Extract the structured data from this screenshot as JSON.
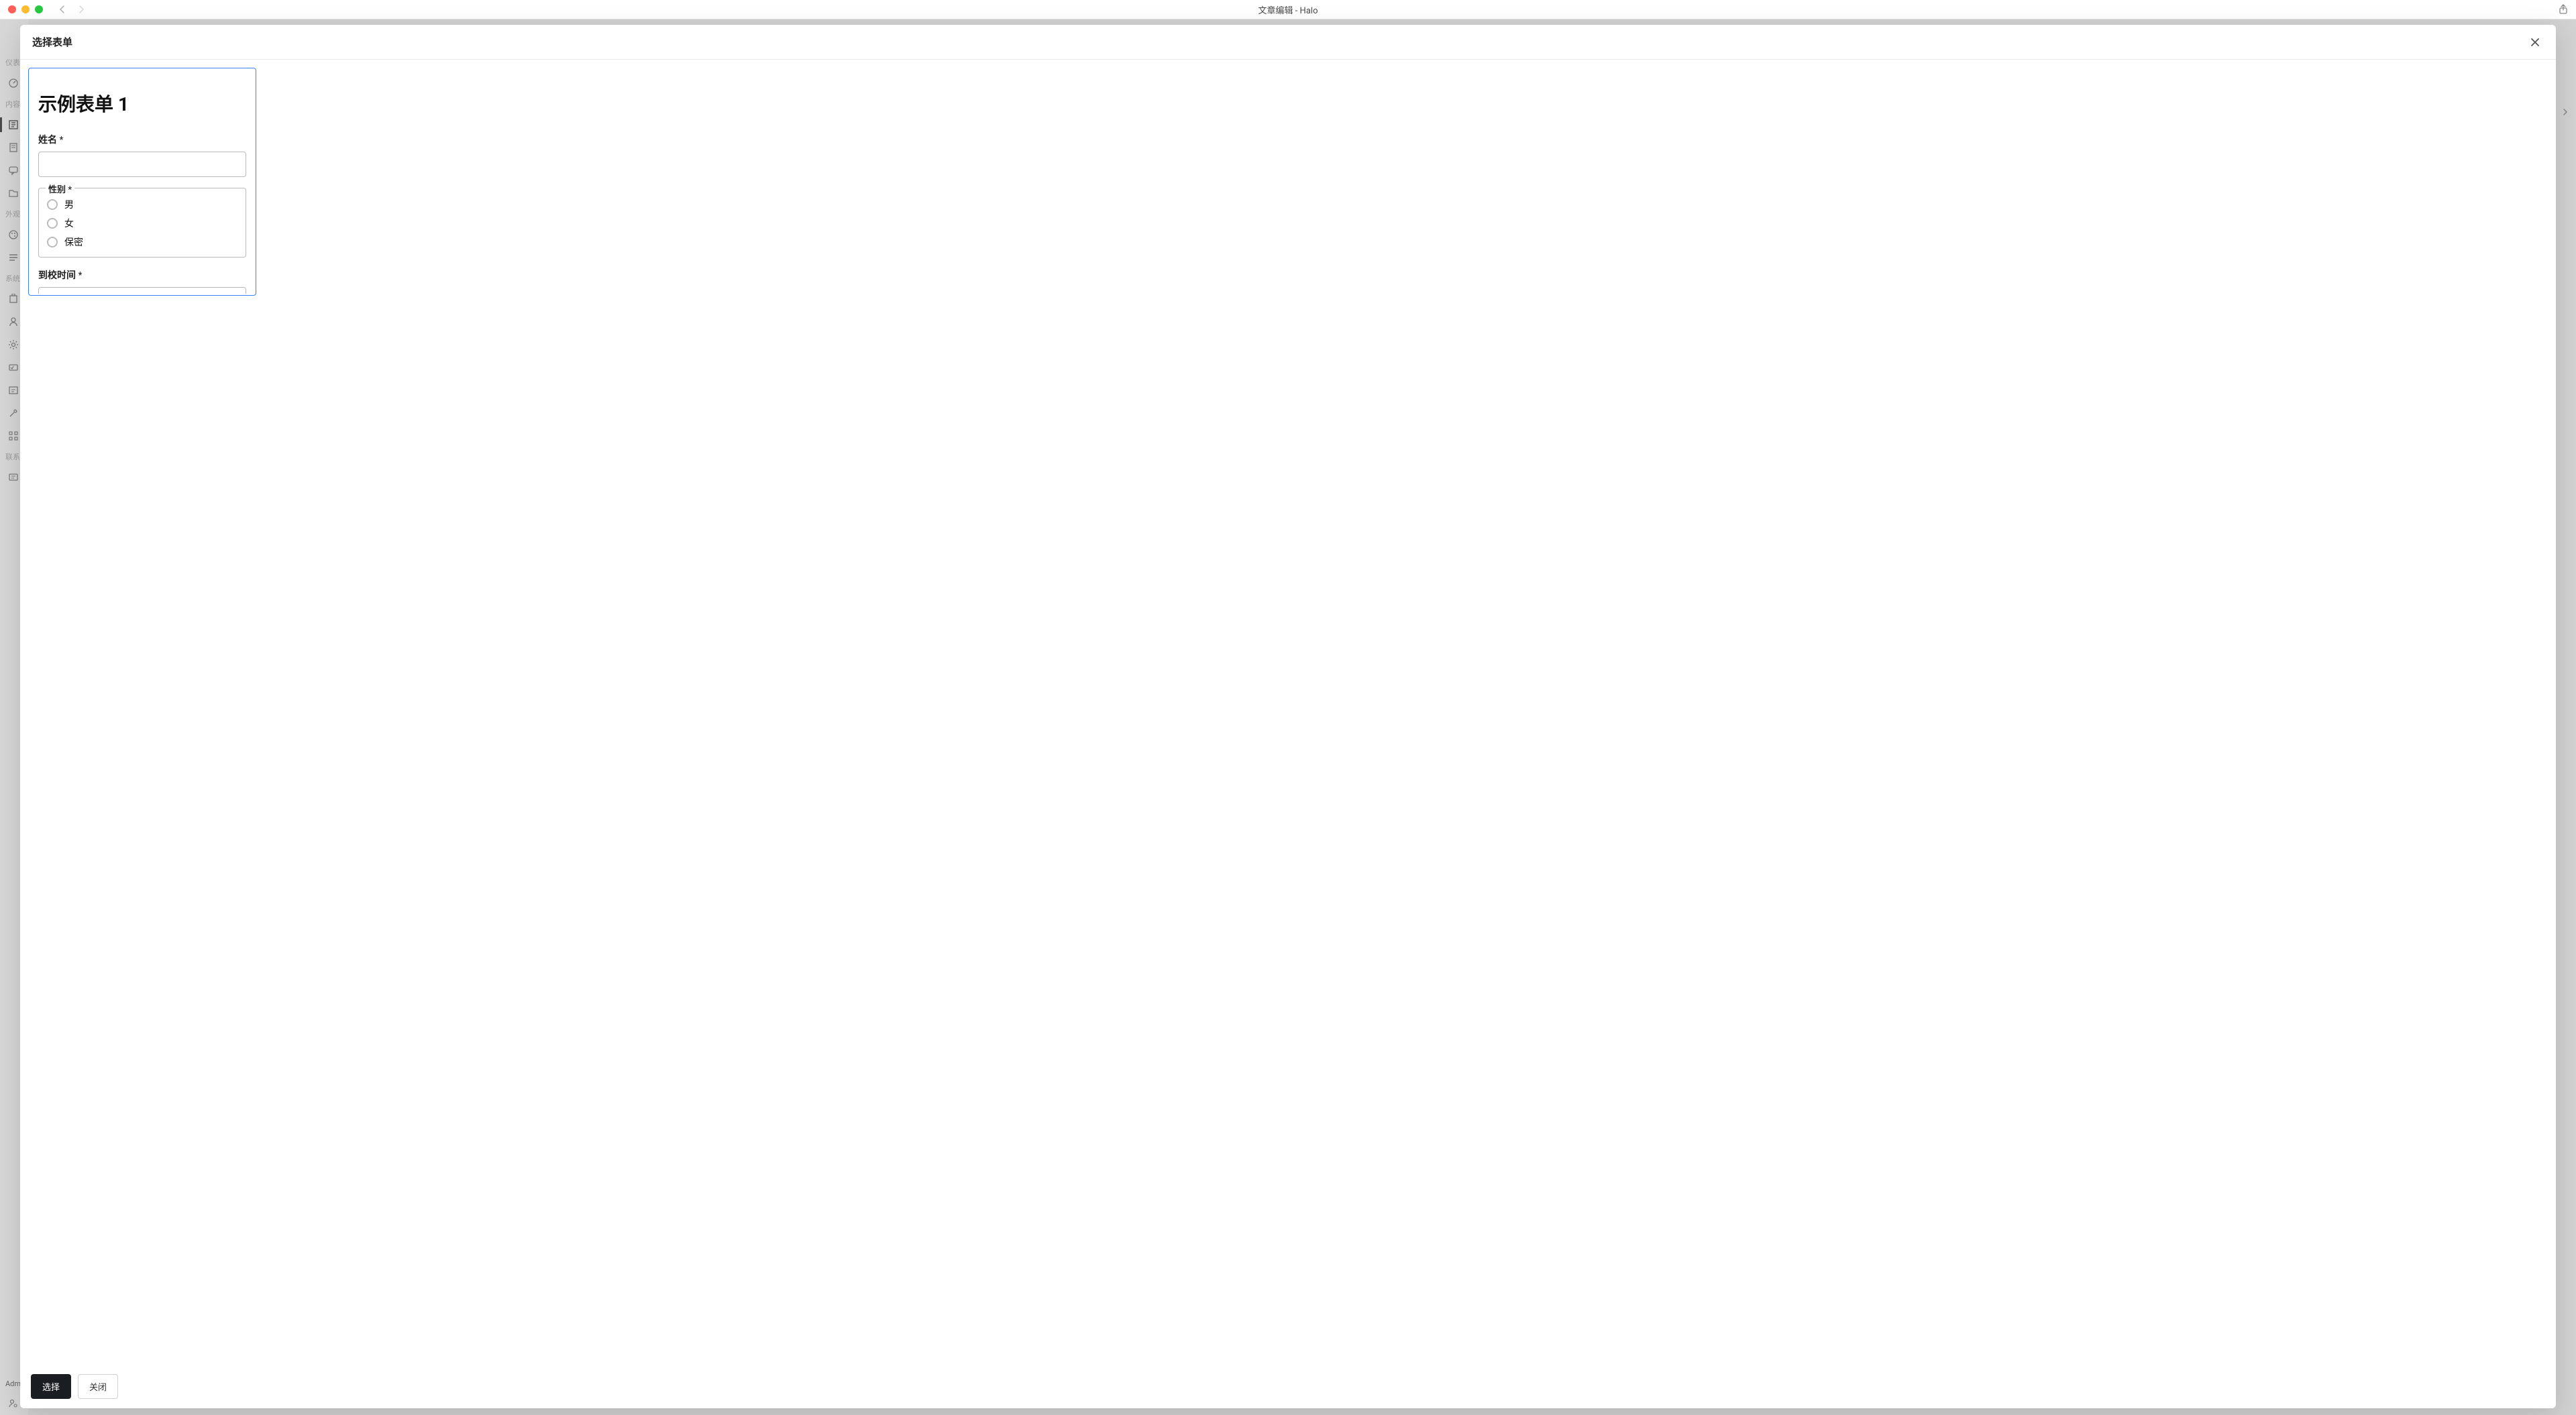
{
  "window": {
    "title": "文章编辑 - Halo"
  },
  "sidebar": {
    "sections": {
      "dashboard": "仪表",
      "content": "内容",
      "appearance": "外观",
      "system": "系统",
      "contact": "联系"
    },
    "user_label": "Admin"
  },
  "modal": {
    "title": "选择表单",
    "select_button": "选择",
    "close_button": "关闭"
  },
  "form_card": {
    "title": "示例表单 1",
    "name_label": "姓名",
    "required_mark": "*",
    "gender_label": "性别",
    "gender_required_mark": "*",
    "gender_options": [
      "男",
      "女",
      "保密"
    ],
    "arrival_label": "到校时间",
    "arrival_required_mark": "*"
  }
}
